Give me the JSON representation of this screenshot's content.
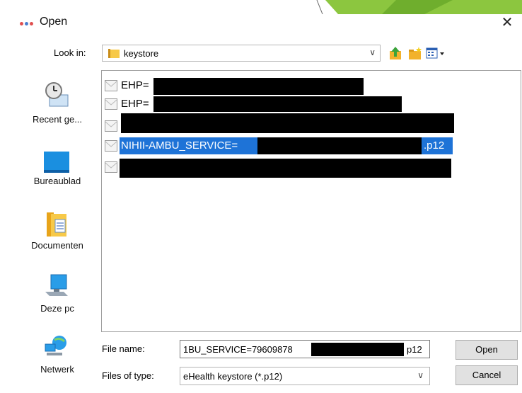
{
  "dialog": {
    "title": "Open",
    "close_glyph": "✕",
    "accent_color": "#1e73d7"
  },
  "look_in": {
    "label": "Look in:",
    "value": "keystore"
  },
  "toolbar": {
    "icons": [
      "up-folder-icon",
      "new-folder-icon",
      "view-menu-icon"
    ]
  },
  "places": [
    {
      "label": "Recent ge...",
      "icon": "recent-clock-icon"
    },
    {
      "label": "Bureaublad",
      "icon": "desktop-icon"
    },
    {
      "label": "Documenten",
      "icon": "documents-icon"
    },
    {
      "label": "Deze pc",
      "icon": "computer-icon"
    },
    {
      "label": "Netwerk",
      "icon": "network-icon"
    }
  ],
  "files": [
    {
      "name": "EHP=",
      "selected": false
    },
    {
      "name": "EHP=",
      "selected": false
    },
    {
      "name": "",
      "selected": false
    },
    {
      "name": "NIHII-AMBU_SERVICE=",
      "suffix": ".p12",
      "selected": true
    },
    {
      "name": "",
      "selected": false
    }
  ],
  "file_name": {
    "label": "File name:",
    "value": "1BU_SERVICE=79609878",
    "value_suffix": "p12"
  },
  "file_type": {
    "label": "Files of type:",
    "value": "eHealth keystore (*.p12)"
  },
  "buttons": {
    "open": "Open",
    "cancel": "Cancel"
  }
}
